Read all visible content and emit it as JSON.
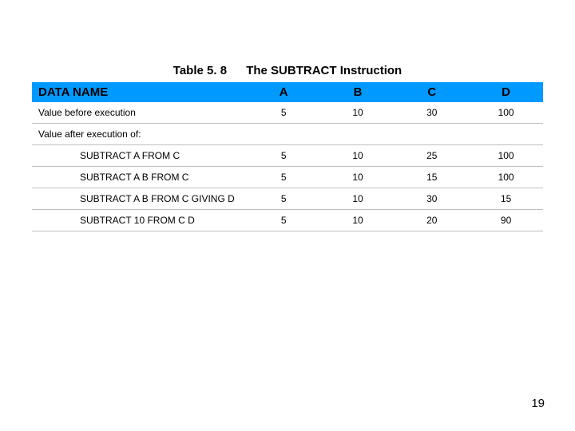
{
  "caption": {
    "table_num": "Table 5. 8",
    "title": "The SUBTRACT Instruction"
  },
  "header": {
    "dataname": "DATA NAME",
    "a": "A",
    "b": "B",
    "c": "C",
    "d": "D"
  },
  "rows": {
    "before": {
      "label": "Value before execution",
      "a": "5",
      "b": "10",
      "c": "30",
      "d": "100"
    },
    "after_section": "Value after execution of:",
    "r1": {
      "label": "SUBTRACT  A   FROM   C",
      "a": "5",
      "b": "10",
      "c": "25",
      "d": "100"
    },
    "r2": {
      "label": "SUBTRACT  A B FROM C",
      "a": "5",
      "b": "10",
      "c": "15",
      "d": "100"
    },
    "r3": {
      "label": "SUBTRACT  A B FROM C GIVING D",
      "a": "5",
      "b": "10",
      "c": "30",
      "d": "15"
    },
    "r4": {
      "label": "SUBTRACT 10 FROM C D",
      "a": "5",
      "b": "10",
      "c": "20",
      "d": "90"
    }
  },
  "page_number": "19",
  "chart_data": {
    "type": "table",
    "title": "Table 5.8 The SUBTRACT Instruction",
    "columns": [
      "DATA NAME",
      "A",
      "B",
      "C",
      "D"
    ],
    "rows": [
      [
        "Value before execution",
        5,
        10,
        30,
        100
      ],
      [
        "SUBTRACT A FROM C",
        5,
        10,
        25,
        100
      ],
      [
        "SUBTRACT A B FROM C",
        5,
        10,
        15,
        100
      ],
      [
        "SUBTRACT A B FROM C GIVING D",
        5,
        10,
        30,
        15
      ],
      [
        "SUBTRACT 10 FROM C D",
        5,
        10,
        20,
        90
      ]
    ]
  }
}
